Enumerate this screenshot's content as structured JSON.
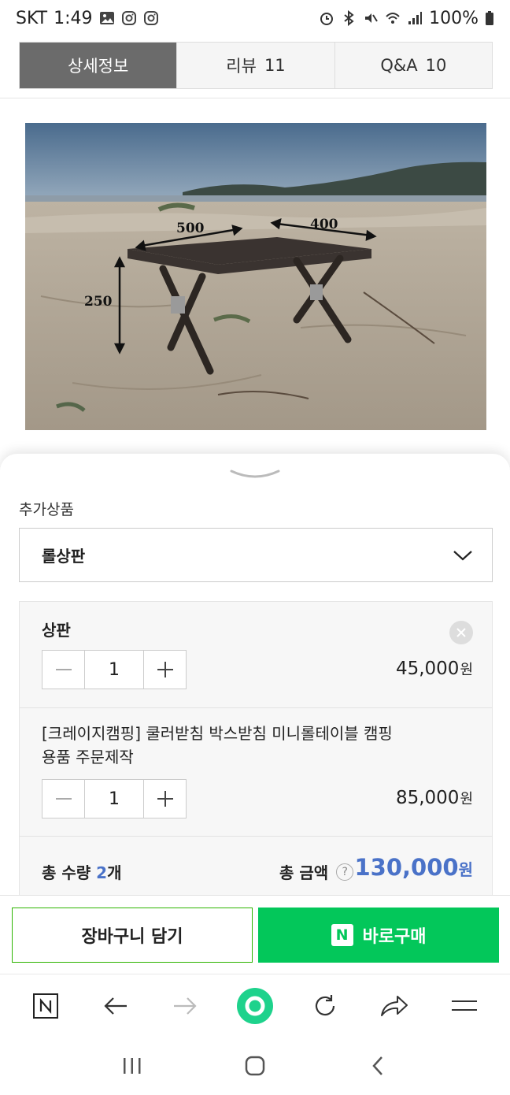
{
  "status_bar": {
    "carrier": "SKT",
    "time": "1:49",
    "battery": "100%"
  },
  "tabs": [
    {
      "label": "상세정보",
      "count": "",
      "active": true
    },
    {
      "label": "리뷰",
      "count": "11",
      "active": false
    },
    {
      "label": "Q&A",
      "count": "10",
      "active": false
    }
  ],
  "photo": {
    "dim_width": "500",
    "dim_depth": "400",
    "dim_height": "250"
  },
  "options": {
    "section_label": "추가상품",
    "selected_option": "롤상판",
    "items": [
      {
        "name": "상판",
        "quantity": "1",
        "price": "45,000",
        "currency": "원"
      },
      {
        "name_line1": "[크레이지캠핑] 쿨러받침 박스받침 미니롤테이블 캠핑",
        "name_line2": "용품 주문제작",
        "quantity": "1",
        "price": "85,000",
        "currency": "원"
      }
    ],
    "total_qty_label": "총 수량",
    "total_qty": "2",
    "total_qty_unit": "개",
    "total_amount_label": "총 금액",
    "total_amount": "130,000",
    "currency": "원"
  },
  "actions": {
    "cart_label": "장바구니 담기",
    "buy_label": "바로구매",
    "buy_logo": "N"
  },
  "colors": {
    "accent_blue": "#4a72c8",
    "naver_green": "#03c75a",
    "tab_active_bg": "#6b6b6b"
  },
  "icons": [
    "image-icon",
    "instagram-icon",
    "alarm-icon",
    "bluetooth-icon",
    "mute-icon",
    "wifi-icon",
    "signal-icon",
    "battery-icon",
    "chevron-down-icon",
    "close-icon",
    "minus-icon",
    "plus-icon",
    "help-icon",
    "naver-icon",
    "back-arrow-icon",
    "forward-arrow-icon",
    "green-circle-icon",
    "refresh-icon",
    "share-icon",
    "menu-icon",
    "recent-apps-icon",
    "home-icon",
    "back-icon"
  ]
}
